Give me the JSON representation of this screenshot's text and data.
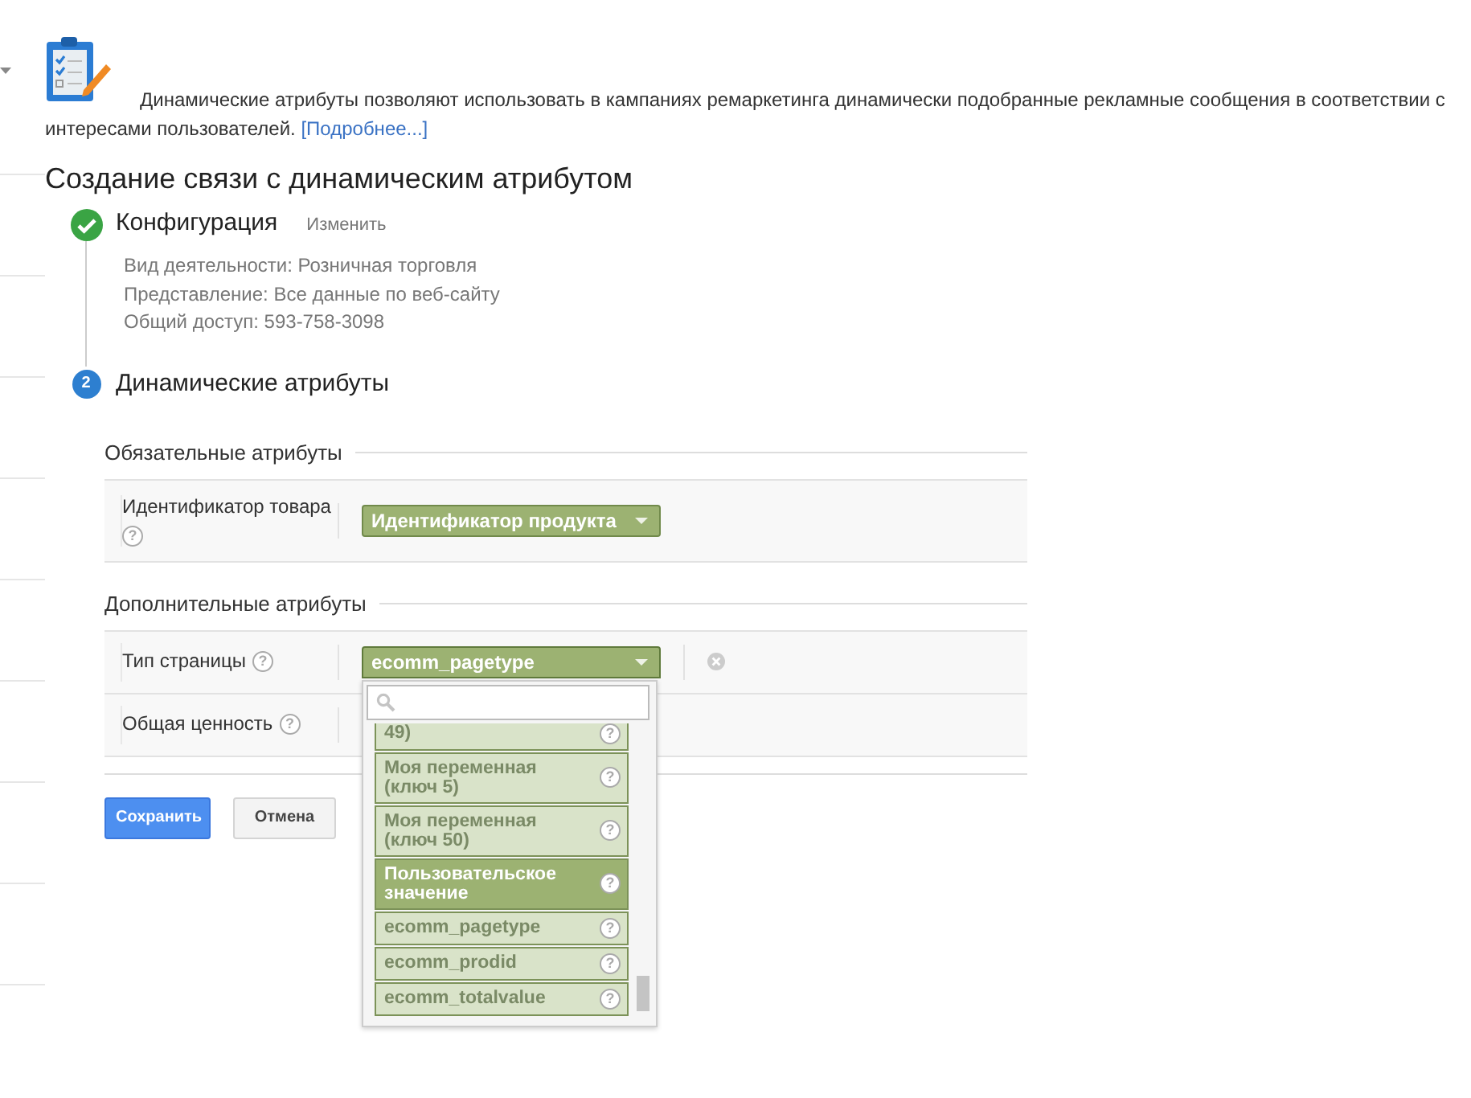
{
  "intro": {
    "text": "Динамические атрибуты позволяют использовать в кампаниях ремаркетинга динамически подобранные рекламные сообщения в соответствии с интересами пользователей.",
    "link": "[Подробнее...]"
  },
  "title": "Создание связи с динамическим атрибутом",
  "steps": [
    {
      "done": true,
      "title": "Конфигурация",
      "action": "Изменить",
      "details": [
        "Вид деятельности: Розничная торговля",
        "Представление: Все данные по веб-сайту",
        "Общий доступ: 593-758-3098"
      ]
    },
    {
      "done": false,
      "number": "2",
      "title": "Динамические атрибуты"
    }
  ],
  "sections": [
    {
      "title": "Обязательные атрибуты",
      "rows": [
        {
          "label": "Идентификатор товара",
          "help": "?",
          "value": "Идентификатор продукта",
          "removable": false
        }
      ]
    },
    {
      "title": "Дополнительные атрибуты",
      "rows": [
        {
          "label": "Тип страницы",
          "help": "?",
          "value": "ecomm_pagetype",
          "removable": true,
          "open": true
        },
        {
          "label": "Общая ценность",
          "help": "?",
          "removable": false
        }
      ]
    }
  ],
  "dropdown": {
    "items": [
      {
        "label": "49)",
        "help": "?",
        "selected": false
      },
      {
        "label": "Моя переменная (ключ 5)",
        "help": "?",
        "selected": false
      },
      {
        "label": "Моя переменная (ключ 50)",
        "help": "?",
        "selected": false
      },
      {
        "label": "Пользовательское значение",
        "help": "?",
        "selected": true
      },
      {
        "label": "ecomm_pagetype",
        "help": "?",
        "selected": false
      },
      {
        "label": "ecomm_prodid",
        "help": "?",
        "selected": false
      },
      {
        "label": "ecomm_totalvalue",
        "help": "?",
        "selected": false
      }
    ]
  },
  "buttons": [
    {
      "label": "Сохранить",
      "kind": "primary"
    },
    {
      "label": "Отмена",
      "kind": "secondary"
    }
  ]
}
